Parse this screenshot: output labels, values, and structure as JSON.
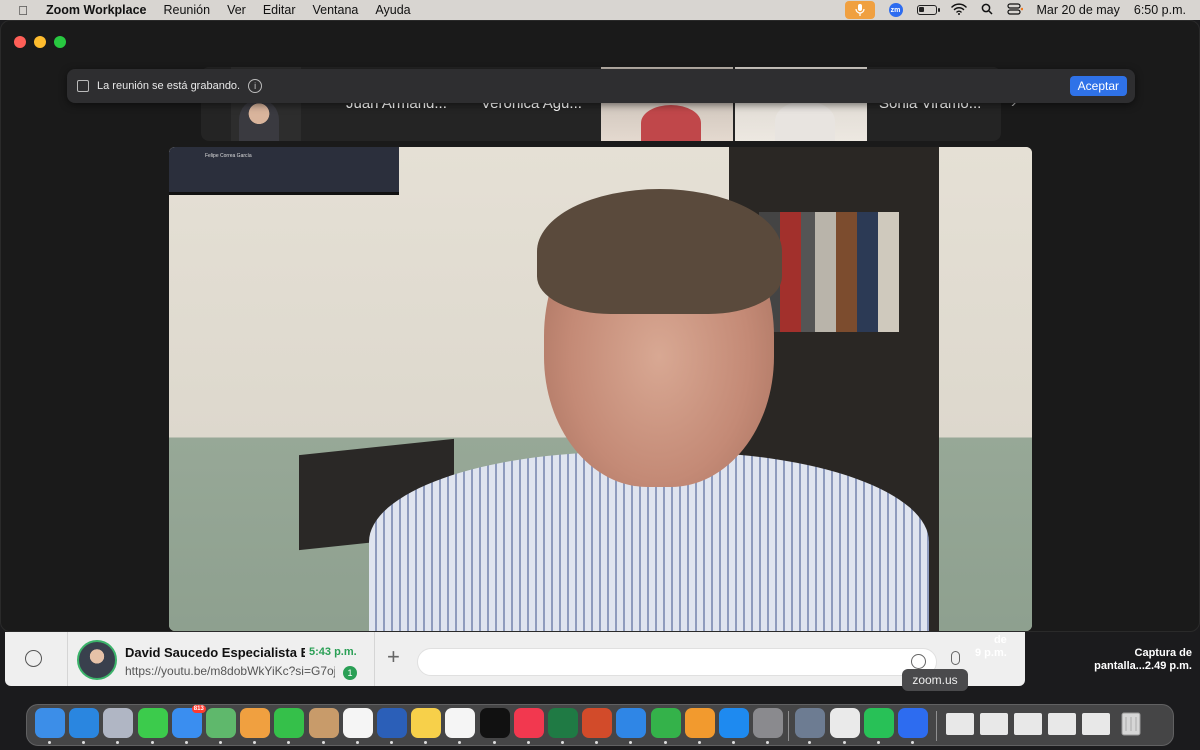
{
  "menubar": {
    "app_name": "Zoom Workplace",
    "menus": [
      "Reunión",
      "Ver",
      "Editar",
      "Ventana",
      "Ayuda"
    ],
    "datetime_date": "Mar 20 de may",
    "datetime_time": "6:50 p.m.",
    "zoom_status_icon": "zm"
  },
  "gallery": {
    "participants": [
      {
        "name": "Juan Armand..."
      },
      {
        "name": "Verónica Agu..."
      },
      {
        "name": "Sonia Viramo..."
      }
    ]
  },
  "recording_banner": {
    "text": "La reunión se está grabando.",
    "accept_label": "Aceptar"
  },
  "main_video": {
    "tv_text": "Felipe Correa García"
  },
  "whatsapp": {
    "chat_name": "David Saucedo Especialista En...",
    "chat_time": "5:43 p.m.",
    "chat_message": "https://youtu.be/m8dobWkYiKc?si=G7oj...",
    "unread_count": "1",
    "plus_label": "+"
  },
  "desktop": {
    "partial_caption_line1": "de",
    "partial_caption_line2": "9 p.m.",
    "screenshot_caption_line1": "Captura de",
    "screenshot_caption_line2": "pantalla...2.49 p.m."
  },
  "dock": {
    "tooltip": "zoom.us",
    "mail_badge": "813",
    "apps": [
      {
        "name": "Finder",
        "icon": "finder-icon",
        "color": "#3c8ee8"
      },
      {
        "name": "Safari",
        "icon": "safari-icon",
        "color": "#2a86e0"
      },
      {
        "name": "Launchpad",
        "icon": "launchpad-icon",
        "color": "#b0b6c4"
      },
      {
        "name": "Messages",
        "icon": "messages-icon",
        "color": "#3ccb4c"
      },
      {
        "name": "Mail",
        "icon": "mail-icon",
        "color": "#3a8ef0"
      },
      {
        "name": "Maps",
        "icon": "maps-icon",
        "color": "#5fb86c"
      },
      {
        "name": "Photos",
        "icon": "photos-icon",
        "color": "#f0a040"
      },
      {
        "name": "FaceTime",
        "icon": "facetime-icon",
        "color": "#35c04a"
      },
      {
        "name": "Contacts",
        "icon": "contacts-icon",
        "color": "#c89b6a"
      },
      {
        "name": "Reminders",
        "icon": "reminders-icon",
        "color": "#f5f5f5"
      },
      {
        "name": "Word",
        "icon": "word-icon",
        "color": "#2b5fb8"
      },
      {
        "name": "Notes",
        "icon": "notes-icon",
        "color": "#f7d04a"
      },
      {
        "name": "Freeform",
        "icon": "freeform-icon",
        "color": "#f5f5f5"
      },
      {
        "name": "TV",
        "icon": "tv-icon",
        "color": "#111111"
      },
      {
        "name": "Music",
        "icon": "music-icon",
        "color": "#f2384f"
      },
      {
        "name": "Excel",
        "icon": "excel-icon",
        "color": "#1f7a44"
      },
      {
        "name": "PowerPoint",
        "icon": "powerpoint-icon",
        "color": "#d24b2a"
      },
      {
        "name": "Keynote",
        "icon": "keynote-icon",
        "color": "#2f86e6"
      },
      {
        "name": "Numbers",
        "icon": "numbers-icon",
        "color": "#34b24a"
      },
      {
        "name": "Pages",
        "icon": "pages-icon",
        "color": "#f29a2e"
      },
      {
        "name": "App Store",
        "icon": "appstore-icon",
        "color": "#1e8af0"
      },
      {
        "name": "System Settings",
        "icon": "settings-icon",
        "color": "#8a8a8e"
      },
      {
        "name": "Preview",
        "icon": "preview-icon",
        "color": "#6d7c92"
      },
      {
        "name": "TextEdit",
        "icon": "textedit-icon",
        "color": "#eaeaea"
      },
      {
        "name": "WhatsApp",
        "icon": "whatsapp-icon",
        "color": "#28c157"
      },
      {
        "name": "Zoom Workplace",
        "icon": "zoom-icon",
        "color": "#2d6cf0"
      }
    ]
  }
}
